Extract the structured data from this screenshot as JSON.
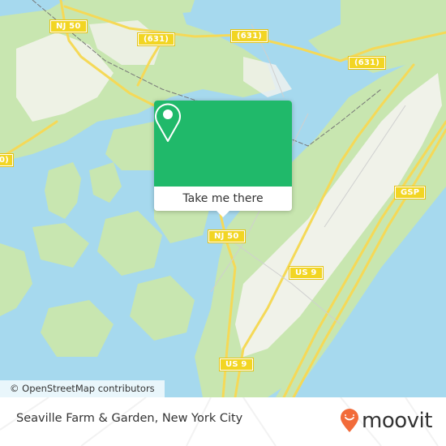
{
  "map": {
    "water_color": "#a6d9ee",
    "land_color": "#c8e6b0",
    "urban_color": "#f4f3ef",
    "road_color": "#f5d957",
    "road_labels": [
      {
        "id": "nj50-north",
        "text": "NJ 50"
      },
      {
        "id": "cr631-west",
        "text": "(631)"
      },
      {
        "id": "cr631-mid",
        "text": "(631)"
      },
      {
        "id": "cr631-east",
        "text": "(631)"
      },
      {
        "id": "partial-west",
        "text": "0)"
      },
      {
        "id": "gsp",
        "text": "GSP"
      },
      {
        "id": "nj50-south",
        "text": "NJ 50"
      },
      {
        "id": "us9-mid",
        "text": "US 9"
      },
      {
        "id": "us9-south",
        "text": "US 9"
      }
    ],
    "attribution": "© OpenStreetMap contributors"
  },
  "popup": {
    "accent_color": "#20b96a",
    "icon": "location-pin-icon",
    "button_label": "Take me there"
  },
  "footer": {
    "title": "Seaville Farm & Garden, New York City",
    "brand": "moovit",
    "brand_color": "#f26b3a"
  }
}
